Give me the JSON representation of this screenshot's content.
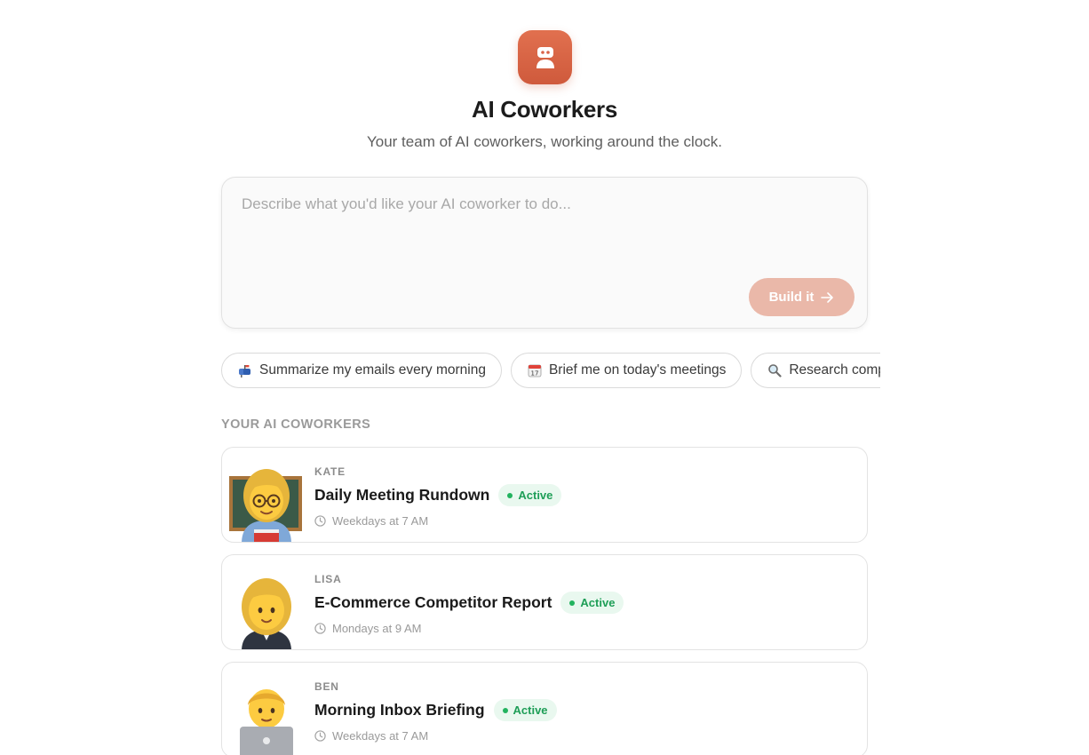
{
  "header": {
    "logo_icon": "robot-icon",
    "title": "AI Coworkers",
    "subtitle": "Your team of AI coworkers, working around the clock."
  },
  "prompt": {
    "placeholder": "Describe what you'd like your AI coworker to do...",
    "value": "",
    "build_label": "Build it",
    "build_icon": "arrow-right-icon"
  },
  "suggestions": [
    {
      "icon": "mailbox-icon",
      "label": "Summarize my emails every morning"
    },
    {
      "icon": "calendar-icon",
      "label": "Brief me on today's meetings"
    },
    {
      "icon": "magnifier-icon",
      "label": "Research competitors"
    }
  ],
  "section": {
    "label": "YOUR AI COWORKERS"
  },
  "coworkers": [
    {
      "name": "KATE",
      "title": "Daily Meeting Rundown",
      "status": "Active",
      "schedule": "Weekdays at 7 AM",
      "avatar": "teacher-emoji-icon"
    },
    {
      "name": "LISA",
      "title": "E-Commerce Competitor Report",
      "status": "Active",
      "schedule": "Mondays at 9 AM",
      "avatar": "businesswoman-emoji-icon"
    },
    {
      "name": "BEN",
      "title": "Morning Inbox Briefing",
      "status": "Active",
      "schedule": "Weekdays at 7 AM",
      "avatar": "technologist-emoji-icon"
    }
  ],
  "colors": {
    "accent": "#d9644a",
    "build_button": "#eab8a9",
    "status_active": "#1e9e57",
    "status_active_bg": "#e9f8ef"
  }
}
